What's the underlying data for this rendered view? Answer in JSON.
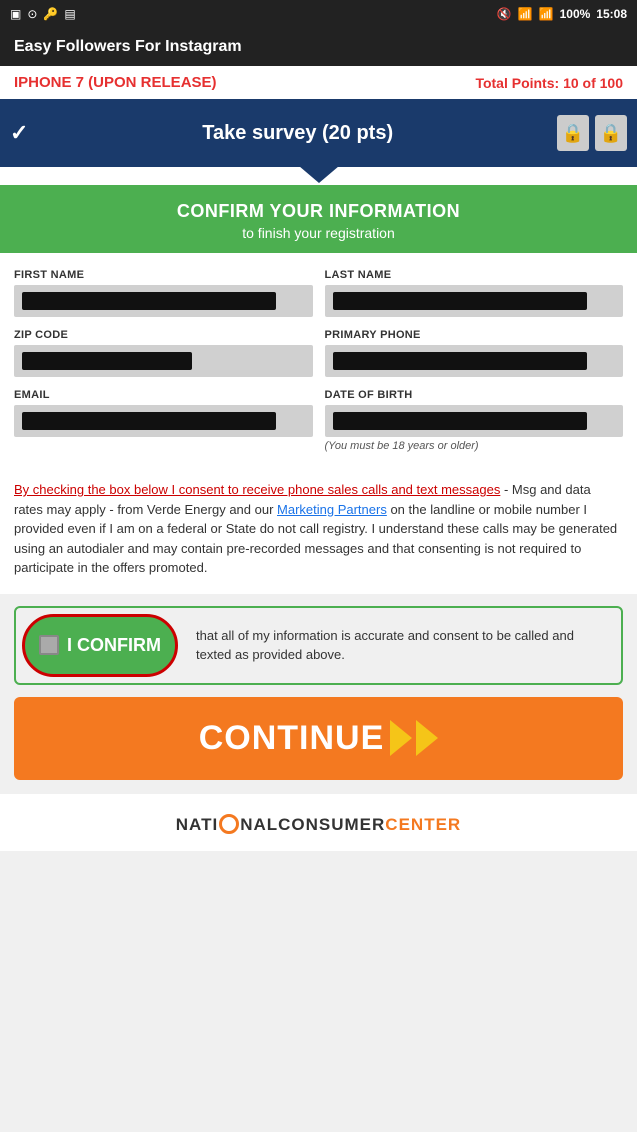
{
  "statusBar": {
    "time": "15:08",
    "battery": "100%",
    "signal": "4G",
    "wifi": true
  },
  "appBar": {
    "title": "Easy Followers For Instagram"
  },
  "pointsBar": {
    "promoTitle": "IPHONE 7 (UPON RELEASE)",
    "pointsLabel": "Total Points:",
    "pointsCurrent": "10",
    "pointsOf": "of",
    "pointsTotal": "100"
  },
  "surveyBanner": {
    "label": "Take survey  (20 pts)"
  },
  "confirmHeader": {
    "title": "CONFIRM YOUR INFORMATION",
    "subtitle": "to finish your registration"
  },
  "form": {
    "firstNameLabel": "FIRST NAME",
    "lastNameLabel": "LAST NAME",
    "zipCodeLabel": "ZIP CODE",
    "primaryPhoneLabel": "PRIMARY PHONE",
    "emailLabel": "EMAIL",
    "dateOfBirthLabel": "DATE OF BIRTH",
    "dobNote": "(You must be 18 years or older)"
  },
  "consent": {
    "text1": "By checking the box below I consent to receive phone sales calls and text messages",
    "text2": " - Msg and data rates may apply - from Verde Energy and our ",
    "linkText": "Marketing Partners",
    "text3": " on the landline or mobile number I provided even if I am on a federal or State do not call registry. I understand these calls may be generated using an autodialer and may contain pre-recorded messages and that consenting is not required to participate in the offers promoted."
  },
  "confirmBox": {
    "buttonLabel": "I CONFIRM",
    "sideText": "that all of my information is accurate and consent to be called and texted as provided above."
  },
  "continueButton": {
    "label": "CONTINUE"
  },
  "footer": {
    "logoLeft": "NATI",
    "logoMiddle": "NALCONSUMER",
    "logoRight": "CENTER"
  }
}
